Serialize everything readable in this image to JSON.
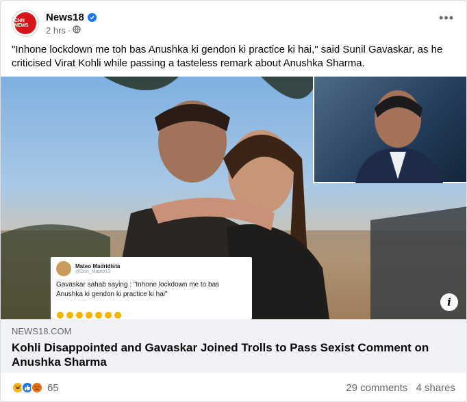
{
  "post": {
    "page_name": "News18",
    "avatar_text": "CNN NEWS",
    "time": "2 hrs",
    "caption": "\"Inhone lockdown me toh bas Anushka ki gendon ki practice ki hai,\" said Sunil Gavaskar, as he criticised Virat Kohli while passing a tasteless remark about Anushka Sharma."
  },
  "image": {
    "tweet": {
      "name": "Mateo Madridista",
      "handle": "@Don_Mateo13",
      "text": "Gavaskar sahab saying : \"Inhone lockdown me to bas Anushka ki gendon ki practice ki hai\""
    }
  },
  "link": {
    "domain": "NEWS18.COM",
    "title": "Kohli Disappointed and Gavaskar Joined Trolls to Pass Sexist Comment on Anushka Sharma"
  },
  "footer": {
    "reaction_count": "65",
    "comments": "29 comments",
    "shares": "4 shares"
  },
  "icons": [
    "globe-icon",
    "verified-badge-icon",
    "more-options-icon",
    "info-icon",
    "haha-reaction-icon",
    "like-reaction-icon",
    "angry-reaction-icon"
  ],
  "colors": {
    "accent": "#1877f2",
    "brand": "#d7141a"
  }
}
